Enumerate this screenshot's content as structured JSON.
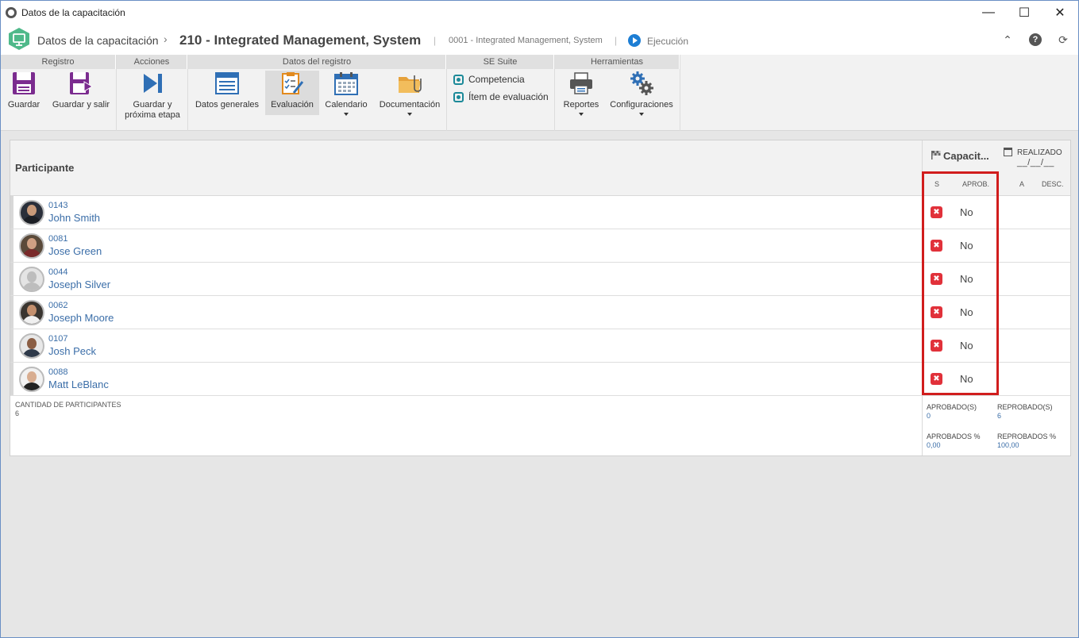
{
  "window": {
    "title": "Datos de la capacitación",
    "minimize_glyph": "—",
    "maximize_glyph": "☐",
    "close_glyph": "✕"
  },
  "header": {
    "breadcrumb_root": "Datos de la capacitación",
    "separator": "›",
    "record_title": "210 - Integrated Management, System",
    "divider": "|",
    "record_subtitle": "0001 - Integrated Management, System",
    "status": "Ejecución",
    "icons": [
      "collapse-icon",
      "help-icon",
      "refresh-icon"
    ],
    "collapse_glyph": "⌃",
    "help_glyph": "?",
    "refresh_glyph": "⟳"
  },
  "ribbon": {
    "groups": [
      {
        "title": "Registro"
      },
      {
        "title": "Acciones"
      },
      {
        "title": "Datos del registro"
      },
      {
        "title": "SE Suite"
      },
      {
        "title": "Herramientas"
      }
    ],
    "buttons": {
      "guardar": "Guardar",
      "guardar_salir": "Guardar y salir",
      "guardar_proxima_1": "Guardar y",
      "guardar_proxima_2": "próxima etapa",
      "datos_generales": "Datos generales",
      "evaluacion": "Evaluación",
      "calendario": "Calendario",
      "documentacion": "Documentación",
      "competencia": "Competencia",
      "item_evaluacion": "Ítem de evaluación",
      "reportes": "Reportes",
      "configuraciones": "Configuraciones"
    },
    "accent": "#7b2c8f"
  },
  "grid": {
    "column_participante": "Participante",
    "capacitacion_title": "Capacit...",
    "realizado_label": "REALIZADO",
    "realizado_date": "__/__/__",
    "subheaders": {
      "s": "S",
      "aprob": "APROB.",
      "a": "A",
      "desc": "DESC."
    },
    "rows": [
      {
        "id": "0143",
        "name": "John Smith",
        "aprob": "No"
      },
      {
        "id": "0081",
        "name": "Jose Green",
        "aprob": "No"
      },
      {
        "id": "0044",
        "name": "Joseph Silver",
        "aprob": "No"
      },
      {
        "id": "0062",
        "name": "Joseph Moore",
        "aprob": "No"
      },
      {
        "id": "0107",
        "name": "Josh Peck",
        "aprob": "No"
      },
      {
        "id": "0088",
        "name": "Matt LeBlanc",
        "aprob": "No"
      }
    ],
    "x_glyph": "✖",
    "footer": {
      "cantidad_label": "CANTIDAD DE PARTICIPANTES",
      "cantidad_value": "6",
      "aprobados_label": "APROBADO(S)",
      "aprobados_value": "0",
      "reprobados_label": "REPROBADO(S)",
      "reprobados_value": "6",
      "aprobados_pct_label": "APROBADOS %",
      "aprobados_pct_value": "0,00",
      "reprobados_pct_label": "REPROBADOS %",
      "reprobados_pct_value": "100,00"
    },
    "highlight_color": "#d11d1d"
  }
}
